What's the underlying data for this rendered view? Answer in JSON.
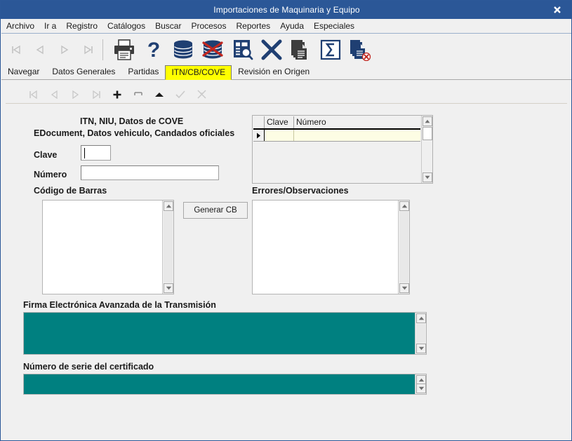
{
  "window": {
    "title": "Importaciones de Maquinaria y Equipo",
    "close_label": "✖",
    "accent_color": "#2b5797",
    "teal_color": "#008080",
    "active_tab_color": "#ffff00"
  },
  "menubar": {
    "items": [
      {
        "label": "Archivo"
      },
      {
        "label": "Ir a"
      },
      {
        "label": "Registro"
      },
      {
        "label": "Catálogos"
      },
      {
        "label": "Buscar"
      },
      {
        "label": "Procesos"
      },
      {
        "label": "Reportes"
      },
      {
        "label": "Ayuda"
      },
      {
        "label": "Especiales"
      }
    ]
  },
  "toolbar": {
    "nav": [
      {
        "name": "first-record",
        "icon": "first-record-icon",
        "enabled": false
      },
      {
        "name": "previous-record",
        "icon": "previous-record-icon",
        "enabled": false
      },
      {
        "name": "next-record",
        "icon": "next-record-icon",
        "enabled": false
      },
      {
        "name": "last-record",
        "icon": "last-record-icon",
        "enabled": false
      }
    ],
    "actions": [
      {
        "name": "print",
        "icon": "printer-icon"
      },
      {
        "name": "help",
        "icon": "question-mark-icon"
      },
      {
        "name": "database",
        "icon": "database-icon"
      },
      {
        "name": "delete-database",
        "icon": "database-delete-icon"
      },
      {
        "name": "query-document",
        "icon": "document-search-icon"
      },
      {
        "name": "close",
        "icon": "x-close-icon"
      },
      {
        "name": "copy",
        "icon": "copy-documents-icon"
      },
      {
        "name": "sum",
        "icon": "sigma-icon"
      },
      {
        "name": "delete-documents",
        "icon": "documents-delete-icon"
      }
    ]
  },
  "tabs": {
    "items": [
      {
        "label": "Navegar",
        "active": false
      },
      {
        "label": "Datos Generales",
        "active": false
      },
      {
        "label": "Partidas",
        "active": false
      },
      {
        "label": "ITN/CB/COVE",
        "active": true
      },
      {
        "label": "Revisión en Origen",
        "active": false
      }
    ]
  },
  "record_nav": {
    "buttons": [
      {
        "name": "first",
        "icon": "first-record-icon",
        "enabled": false
      },
      {
        "name": "previous",
        "icon": "previous-record-icon",
        "enabled": false
      },
      {
        "name": "next",
        "icon": "next-record-icon",
        "enabled": false
      },
      {
        "name": "last",
        "icon": "last-record-icon",
        "enabled": false
      },
      {
        "name": "add",
        "icon": "plus-icon",
        "enabled": true
      },
      {
        "name": "delete",
        "icon": "minus-rect-icon",
        "enabled": true
      },
      {
        "name": "edit",
        "icon": "triangle-up-icon",
        "enabled": true
      },
      {
        "name": "post",
        "icon": "check-icon",
        "enabled": false
      },
      {
        "name": "cancel",
        "icon": "cancel-x-icon",
        "enabled": false
      }
    ]
  },
  "form": {
    "heading_line1": "ITN, NIU, Datos de COVE",
    "heading_line2": "EDocument, Datos vehiculo, Candados oficiales",
    "clave_label": "Clave",
    "clave_value": "",
    "clave_placeholder": "",
    "numero_label": "Número",
    "numero_value": "",
    "numero_placeholder": "",
    "codigo_barras_label": "Código de Barras",
    "codigo_barras_value": "",
    "generar_cb_label": "Generar CB",
    "errores_label": "Errores/Observaciones",
    "errores_value": "",
    "firma_label": "Firma Electrónica Avanzada  de la Transmisión",
    "firma_value": "",
    "certificado_label": "Número de serie del certificado",
    "certificado_value": ""
  },
  "grid": {
    "columns": [
      {
        "label": "Clave",
        "width": 42
      },
      {
        "label": "Número",
        "width": 172
      }
    ],
    "rows": [
      {
        "selected": true,
        "cells": [
          "",
          ""
        ]
      }
    ],
    "row_marker": "▶"
  }
}
